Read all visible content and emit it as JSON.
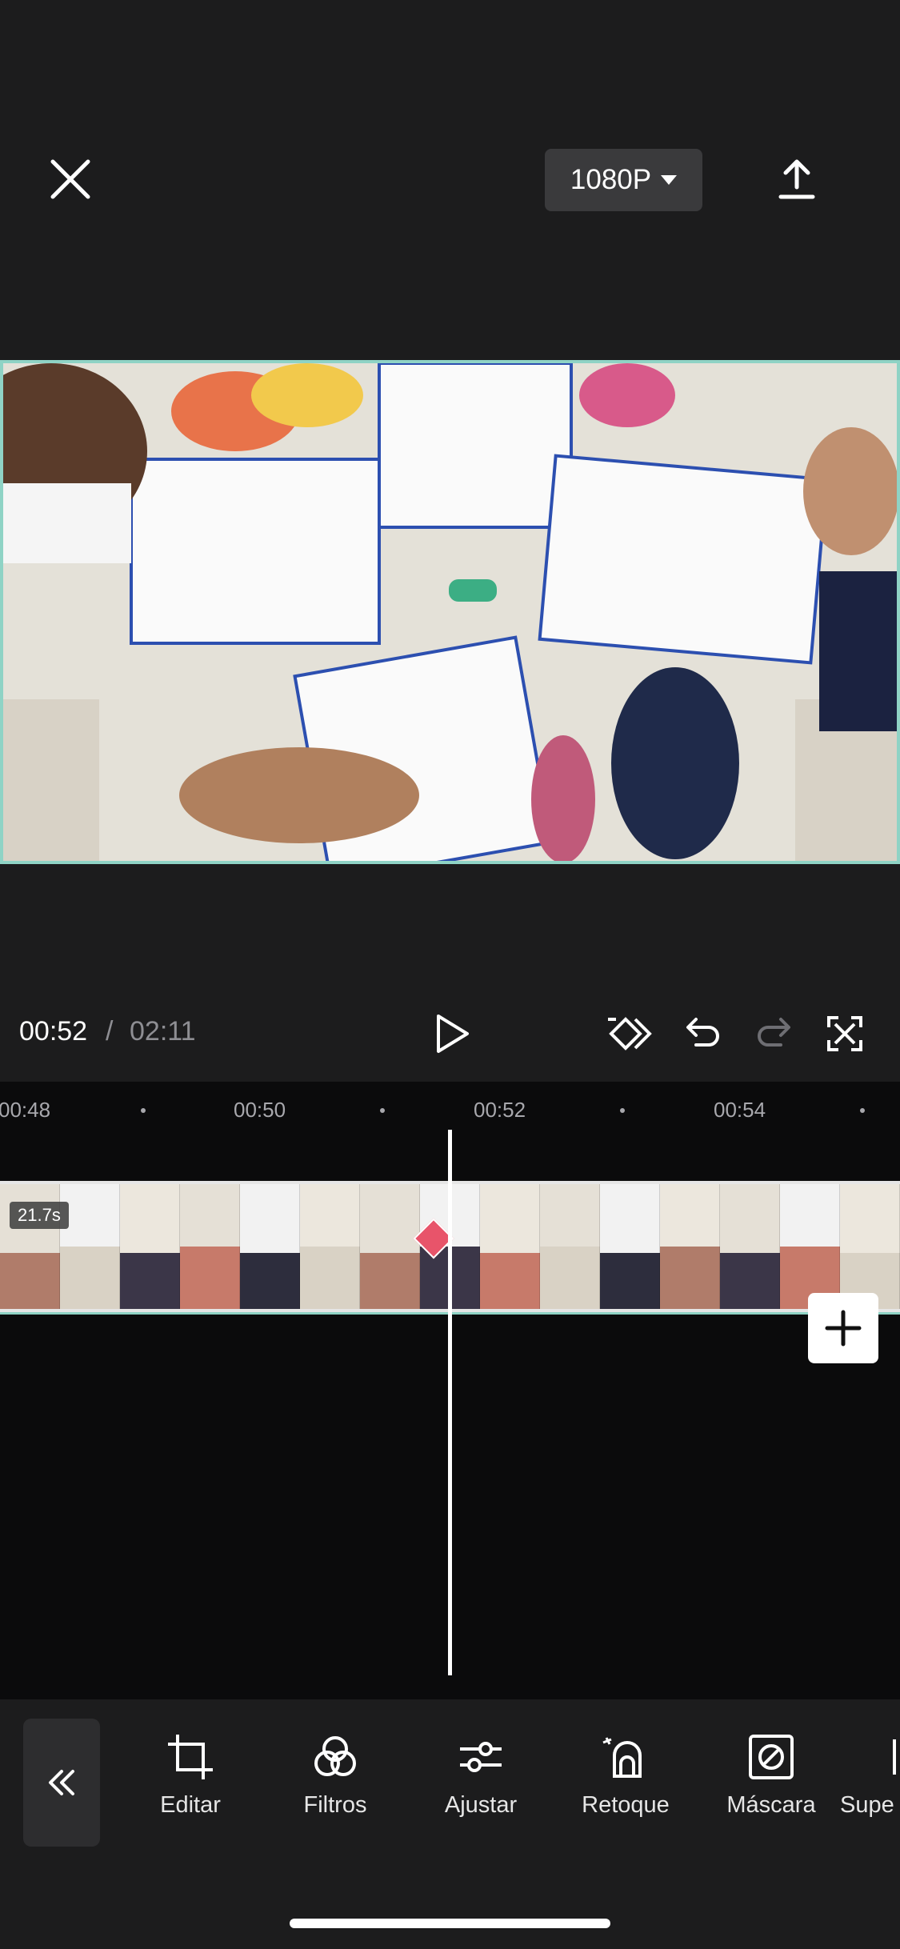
{
  "top_bar": {
    "resolution": "1080P"
  },
  "playback": {
    "current_time": "00:52",
    "separator": "/",
    "total_time": "02:11"
  },
  "timeline": {
    "ruler_labels": [
      "00:48",
      "00:50",
      "00:52",
      "00:54"
    ],
    "clip_duration": "21.7s"
  },
  "toolbar": {
    "items": [
      {
        "label": "Editar",
        "icon": "crop-icon"
      },
      {
        "label": "Filtros",
        "icon": "filters-icon"
      },
      {
        "label": "Ajustar",
        "icon": "adjust-icon"
      },
      {
        "label": "Retoque",
        "icon": "retouch-icon"
      },
      {
        "label": "Máscara",
        "icon": "mask-icon"
      },
      {
        "label": "Supe",
        "icon": "overlay-icon"
      }
    ]
  },
  "colors": {
    "accent_teal": "#8fd3c5",
    "keyframe": "#e8546a",
    "background": "#1c1c1d"
  }
}
